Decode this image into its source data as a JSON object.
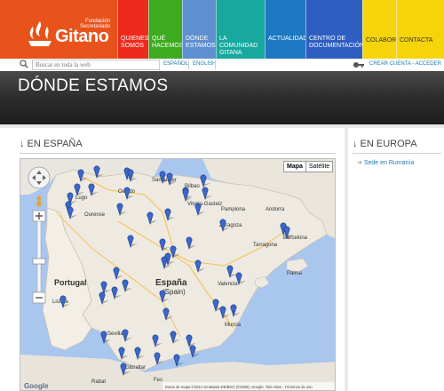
{
  "logo": {
    "line1": "Fundación",
    "line2": "Secretariado",
    "name": "Gitano"
  },
  "nav": [
    {
      "label": "QUIENES SOMOS",
      "color": "#ee2a1d"
    },
    {
      "label": "QUÉ HACEMOS",
      "color": "#3daa1f"
    },
    {
      "label": "DÓNDE ESTAMOS",
      "color": "#5e8fd0"
    },
    {
      "label": "LA COMUNIDAD GITANA",
      "color": "#17a89e"
    },
    {
      "label": "ACTUALIDAD",
      "color": "#1e78c2"
    },
    {
      "label": "CENTRO DE DOCUMENTACIÓN",
      "color": "#2e5ec2"
    },
    {
      "label": "COLABORA",
      "color": "#f6d40a"
    },
    {
      "label": "CONTACTA",
      "color": "#f6d40a"
    }
  ],
  "search": {
    "placeholder": "Buscar en toda la web"
  },
  "languages": {
    "es": "ESPAÑOL",
    "en": "ENGLISH"
  },
  "account": "CREAR CUENTA - ACCEDER",
  "page_title": "DÓNDE ESTAMOS",
  "spain_section": "↓ EN ESPAÑA",
  "europe_section": "↓ EN EUROPA",
  "europe_links": [
    "Sede en Rumanía"
  ],
  "map": {
    "type_map": "Mapa",
    "type_satellite": "Satélite",
    "labels": {
      "oviedo": "Oviedo",
      "santander": "Santander",
      "bilbao": "Bilbao",
      "lugo": "Lugo",
      "ourense": "Ourense",
      "vitoria": "Vitoria-Gasteiz",
      "pamplona": "Pamplona",
      "andorra": "Andorra",
      "zaragoza": "Zaragoza",
      "barcelona": "Barcelona",
      "tarragona": "Tarragona",
      "portugal": "Portugal",
      "espana": "España",
      "spain": "(Spain)",
      "valencia": "Valencia",
      "lisboa": "Lisboa",
      "murcia": "Murcia",
      "sevilla": "Sevilla",
      "gibraltar": "Gibraltar",
      "palma": "Palma",
      "rabat": "Rabat",
      "fes": "Fes"
    },
    "attribution": "Datos de mapa ©2012 GeoBasis-DE/BKG (©2009), Google, Tele Atlas - Términos de uso",
    "google": "Google"
  }
}
